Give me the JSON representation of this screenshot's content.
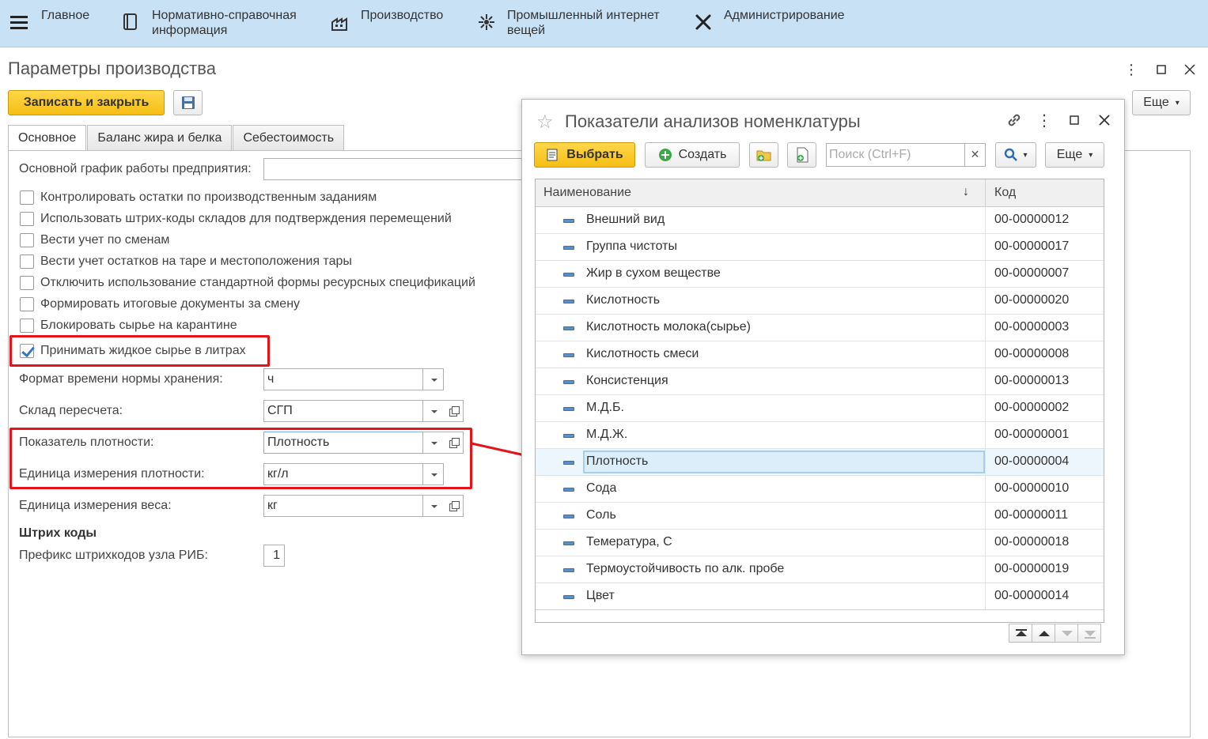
{
  "top_menu": {
    "items": [
      {
        "label": "Главное",
        "icon": "menu-icon"
      },
      {
        "label": "Нормативно-справочная\nинформация",
        "icon": "book-icon"
      },
      {
        "label": "Производство",
        "icon": "factory-icon"
      },
      {
        "label": "Промышленный интернет\nвещей",
        "icon": "network-icon"
      },
      {
        "label": "Администрирование",
        "icon": "tools-icon"
      }
    ]
  },
  "form": {
    "title": "Параметры производства",
    "save_close_label": "Записать и закрыть",
    "more_label": "Еще",
    "tabs": [
      "Основное",
      "Баланс жира и белка",
      "Себестоимость"
    ],
    "schedule_label": "Основной график работы предприятия:",
    "schedule_value": "",
    "checkboxes": [
      {
        "label": "Контролировать остатки по производственным заданиям",
        "checked": false
      },
      {
        "label": "Использовать штрих-коды складов для подтверждения перемещений",
        "checked": false
      },
      {
        "label": "Вести учет по сменам",
        "checked": false
      },
      {
        "label": "Вести учет остатков на таре и местоположения тары",
        "checked": false
      },
      {
        "label": "Отключить использование стандартной формы ресурсных спецификаций",
        "checked": false
      },
      {
        "label": "Формировать итоговые документы за смену",
        "checked": false
      },
      {
        "label": "Блокировать сырье на карантине",
        "checked": false
      },
      {
        "label": "Принимать жидкое сырье в литрах",
        "checked": true
      }
    ],
    "storage_time_label": "Формат времени нормы хранения:",
    "storage_time_value": "ч",
    "recalc_warehouse_label": "Склад пересчета:",
    "recalc_warehouse_value": "СГП",
    "density_indicator_label": "Показатель плотности:",
    "density_indicator_value": "Плотность",
    "density_unit_label": "Единица измерения плотности:",
    "density_unit_value": "кг/л",
    "weight_unit_label": "Единица измерения веса:",
    "weight_unit_value": "кг",
    "barcodes_heading": "Штрих коды",
    "rib_prefix_label": "Префикс штрихкодов узла РИБ:",
    "rib_prefix_value": "1"
  },
  "popup": {
    "title": "Показатели анализов номенклатуры",
    "select_label": "Выбрать",
    "create_label": "Создать",
    "search_placeholder": "Поиск (Ctrl+F)",
    "more_label": "Еще",
    "columns": {
      "name": "Наименование",
      "code": "Код"
    },
    "rows": [
      {
        "name": "Внешний вид",
        "code": "00-00000012"
      },
      {
        "name": "Группа чистоты",
        "code": "00-00000017"
      },
      {
        "name": "Жир в сухом веществе",
        "code": "00-00000007"
      },
      {
        "name": "Кислотность",
        "code": "00-00000020"
      },
      {
        "name": "Кислотность молока(сырье)",
        "code": "00-00000003"
      },
      {
        "name": "Кислотность смеси",
        "code": "00-00000008"
      },
      {
        "name": "Консистенция",
        "code": "00-00000013"
      },
      {
        "name": "М.Д.Б.",
        "code": "00-00000002"
      },
      {
        "name": "М.Д.Ж.",
        "code": "00-00000001"
      },
      {
        "name": "Плотность",
        "code": "00-00000004"
      },
      {
        "name": "Сода",
        "code": "00-00000010"
      },
      {
        "name": "Соль",
        "code": "00-00000011"
      },
      {
        "name": "Темература, С",
        "code": "00-00000018"
      },
      {
        "name": "Термоустойчивость по алк. пробе",
        "code": "00-00000019"
      },
      {
        "name": "Цвет",
        "code": "00-00000014"
      }
    ],
    "selected_index": 9
  },
  "colors": {
    "accent_yellow": "#f5be13",
    "highlight_red": "#e3141a",
    "menu_bg": "#c9e1f4"
  }
}
